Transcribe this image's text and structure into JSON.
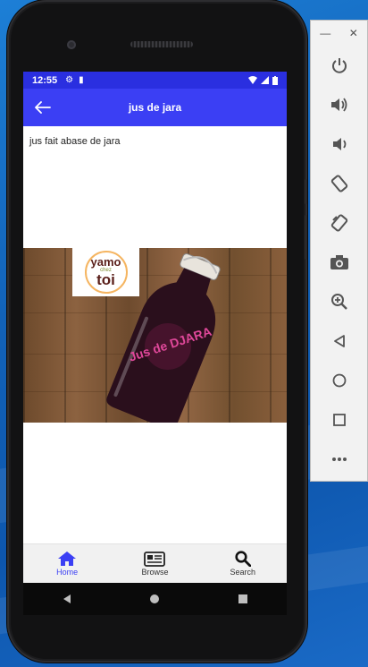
{
  "status_bar": {
    "time": "12:55"
  },
  "app_bar": {
    "title": "jus de jara"
  },
  "content": {
    "description": "jus fait abase de jara"
  },
  "product_image": {
    "logo_line1": "yamo",
    "logo_line2": "chez",
    "logo_line3": "toi",
    "bottle_label": "Jus de DJARA"
  },
  "bottom_nav": {
    "items": [
      {
        "label": "Home",
        "icon": "home-icon",
        "active": true
      },
      {
        "label": "Browse",
        "icon": "newspaper-icon",
        "active": false
      },
      {
        "label": "Search",
        "icon": "search-icon",
        "active": false
      }
    ]
  },
  "emulator_panel": {
    "window_controls": [
      "minimize-icon",
      "close-icon"
    ],
    "tools": [
      "power-icon",
      "volume-up-icon",
      "volume-down-icon",
      "rotate-left-icon",
      "rotate-right-icon",
      "camera-icon",
      "zoom-icon",
      "back-icon",
      "home-icon",
      "overview-icon",
      "more-icon"
    ]
  },
  "colors": {
    "app_bar": "#3b3ff4",
    "status_bar": "#2a2fe0",
    "nav_active": "#3b3ff4"
  }
}
